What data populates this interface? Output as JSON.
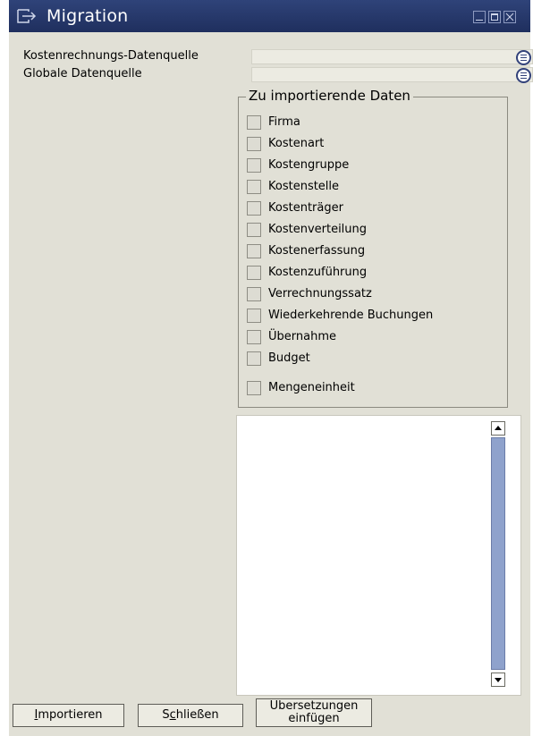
{
  "window": {
    "title": "Migration",
    "title_bar_color": "#253a6e",
    "background_color": "#e1e0d6"
  },
  "fields": [
    {
      "label": "Kostenrechnungs-Datenquelle",
      "value": ""
    },
    {
      "label": "Globale Datenquelle",
      "value": ""
    }
  ],
  "import_group": {
    "title": "Zu importierende Daten",
    "items": [
      {
        "label": "Firma",
        "checked": false
      },
      {
        "label": "Kostenart",
        "checked": false
      },
      {
        "label": "Kostengruppe",
        "checked": false
      },
      {
        "label": "Kostenstelle",
        "checked": false
      },
      {
        "label": "Kostenträger",
        "checked": false
      },
      {
        "label": "Kostenverteilung",
        "checked": false
      },
      {
        "label": "Kostenerfassung",
        "checked": false
      },
      {
        "label": "Kostenzuführung",
        "checked": false
      },
      {
        "label": "Verrechnungssatz",
        "checked": false
      },
      {
        "label": "Wiederkehrende Buchungen",
        "checked": false
      },
      {
        "label": "Übernahme",
        "checked": false
      },
      {
        "label": "Budget",
        "checked": false
      },
      {
        "label": "Mengeneinheit",
        "checked": false
      }
    ]
  },
  "log": {
    "text": ""
  },
  "buttons": {
    "import_prefix": "I",
    "import_rest": "mportieren",
    "close_prefix": "S",
    "close_underlined": "c",
    "close_rest": "hließen",
    "translations_line1": "Übersetzungen",
    "translations_line2": "einfügen"
  },
  "icons": {
    "title": "window-title-icon",
    "list_button": "list-button-icon",
    "scroll_up": "arrow-up-icon",
    "scroll_down": "arrow-down-icon"
  }
}
